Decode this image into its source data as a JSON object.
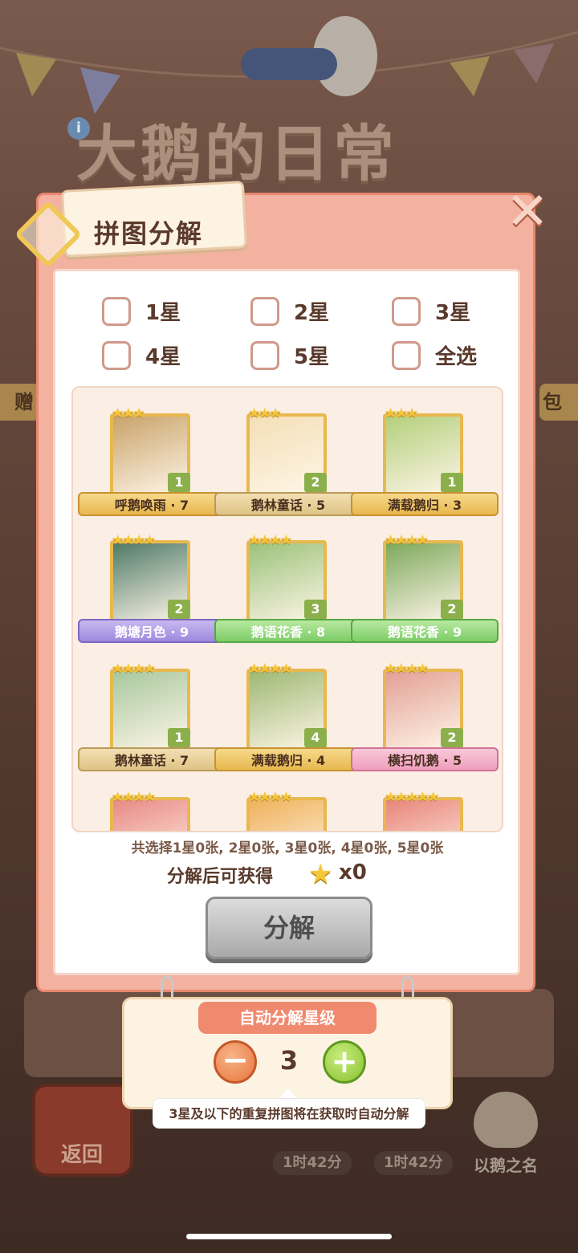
{
  "background": {
    "title": "大鹅的日常",
    "side_left": "赠",
    "side_right": "包",
    "return_label": "返回",
    "timers": [
      "1时42分",
      "1时42分"
    ],
    "name_label": "以鹅之名"
  },
  "dialog": {
    "title": "拼图分解",
    "close_label": "✕",
    "filters": [
      {
        "label": "1星",
        "checked": false
      },
      {
        "label": "2星",
        "checked": false
      },
      {
        "label": "3星",
        "checked": false
      },
      {
        "label": "4星",
        "checked": false
      },
      {
        "label": "5星",
        "checked": false
      },
      {
        "label": "全选",
        "checked": false
      }
    ],
    "pieces": [
      {
        "name": "呼鹅唤雨 · 7",
        "stars": "★★★",
        "count": "1",
        "ribbon": "gold",
        "color": "#c9a36a"
      },
      {
        "name": "鹅林童话 · 5",
        "stars": "★★★",
        "count": "2",
        "ribbon": "tan",
        "color": "#f4dfb6"
      },
      {
        "name": "满载鹅归 · 3",
        "stars": "★★★",
        "count": "1",
        "ribbon": "gold",
        "color": "#b4cf7c"
      },
      {
        "name": "鹅塘月色 · 9",
        "stars": "★★★★",
        "count": "2",
        "ribbon": "purple",
        "color": "#4f7a67"
      },
      {
        "name": "鹅语花香 · 8",
        "stars": "★★★★",
        "count": "3",
        "ribbon": "green",
        "color": "#9bc27a"
      },
      {
        "name": "鹅语花香 · 9",
        "stars": "★★★★",
        "count": "2",
        "ribbon": "green",
        "color": "#7da95c"
      },
      {
        "name": "鹅林童话 · 7",
        "stars": "★★★★",
        "count": "1",
        "ribbon": "tan",
        "color": "#a8c89e"
      },
      {
        "name": "满载鹅归 · 4",
        "stars": "★★★★",
        "count": "4",
        "ribbon": "gold",
        "color": "#9eb873"
      },
      {
        "name": "横扫饥鹅 · 5",
        "stars": "★★★★",
        "count": "2",
        "ribbon": "pink",
        "color": "#e3a096"
      },
      {
        "name": "",
        "stars": "★★★★",
        "count": "",
        "ribbon": "none",
        "color": "#e98a86"
      },
      {
        "name": "",
        "stars": "★★★★",
        "count": "",
        "ribbon": "none",
        "color": "#f0b25c"
      },
      {
        "name": "",
        "stars": "★★★★★",
        "count": "",
        "ribbon": "none",
        "color": "#e9867c"
      }
    ],
    "summary": "共选择1星0张, 2星0张, 3星0张, 4星0张, 5星0张",
    "reward_label": "分解后可获得",
    "reward_value": "x0",
    "decompose_label": "分解"
  },
  "auto_decompose": {
    "title": "自动分解星级",
    "minus": "−",
    "plus": "+",
    "level": "3",
    "hint": "3星及以下的重复拼图将在获取时自动分解"
  }
}
